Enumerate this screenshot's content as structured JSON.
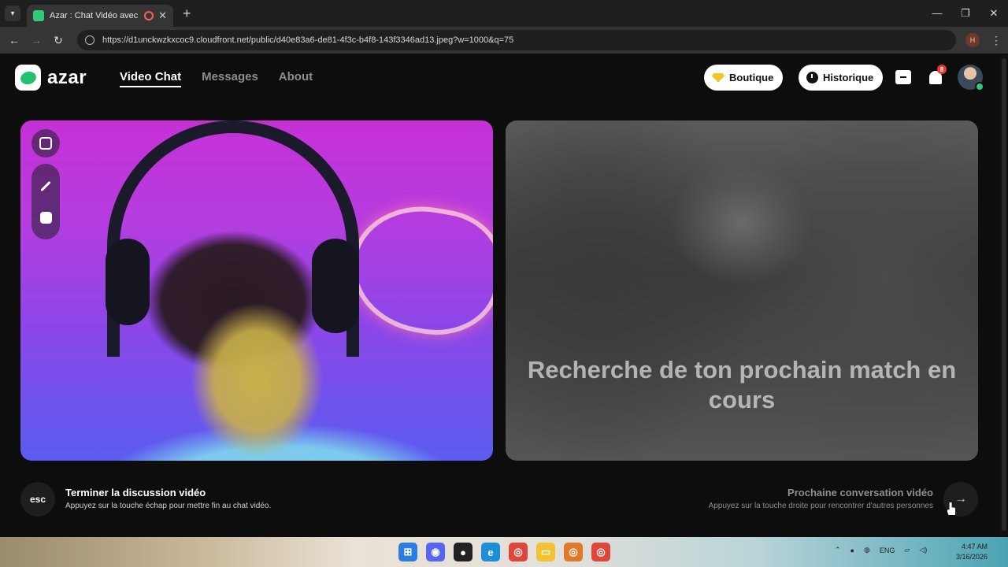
{
  "browser": {
    "tab_title": "Azar : Chat Vidéo avec de n",
    "tab_close": "✕",
    "new_tab": "+",
    "url": "https://d1unckwzkxcoc9.cloudfront.net/public/d40e83a6-de81-4f3c-b4f8-143f3346ad13.jpeg?w=1000&q=75",
    "profile_initial": "H",
    "win_controls": [
      "—",
      "❐",
      "✕"
    ]
  },
  "header": {
    "logo_text": "azar",
    "nav": [
      {
        "label": "Video Chat",
        "active": true
      },
      {
        "label": "Messages",
        "active": false
      },
      {
        "label": "About",
        "active": false
      }
    ],
    "shop_label": "Boutique",
    "history_label": "Historique",
    "notification_count": "8"
  },
  "main": {
    "search_status": "Recherche de ton prochain match en cours"
  },
  "footer": {
    "esc_key": "esc",
    "end_title": "Terminer la discussion vidéo",
    "end_subtitle": "Appuyez sur la touche échap pour mettre fin au chat vidéo.",
    "next_title": "Prochaine conversation vidéo",
    "next_subtitle": "Appuyez sur la touche droite pour rencontrer d'autres personnes",
    "next_arrow": "→"
  },
  "taskbar": {
    "language": "ENG",
    "time": "4:47 AM",
    "date": "3/16/2026"
  },
  "colors": {
    "brand_green": "#2fc97a",
    "gem_yellow": "#f7c325",
    "badge_red": "#e53935"
  }
}
